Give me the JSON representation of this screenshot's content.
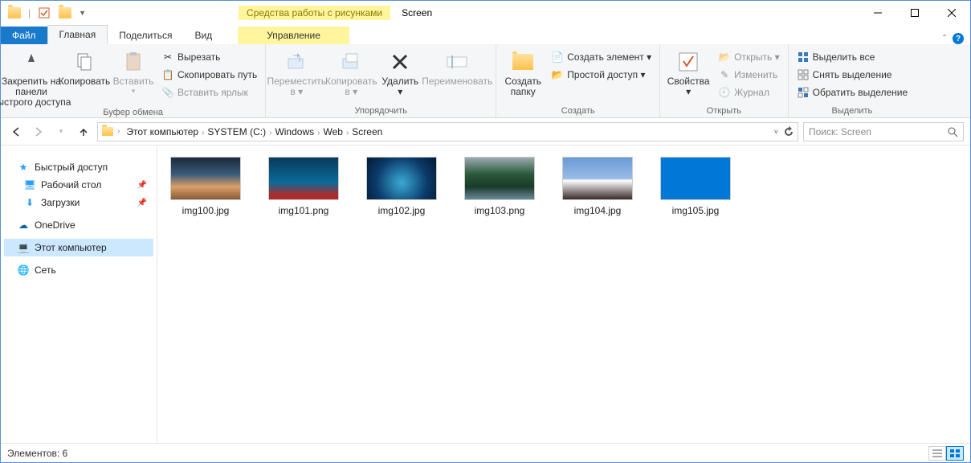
{
  "title": "Screen",
  "contextTabTitle": "Средства работы с рисунками",
  "tabs": {
    "file": "Файл",
    "home": "Главная",
    "share": "Поделиться",
    "view": "Вид",
    "manage": "Управление"
  },
  "ribbon": {
    "clipboard": {
      "label": "Буфер обмена",
      "pin": "Закрепить на панели\nбыстрого доступа",
      "copy": "Копировать",
      "paste": "Вставить",
      "cut": "Вырезать",
      "copypath": "Скопировать путь",
      "pastelink": "Вставить ярлык"
    },
    "organize": {
      "label": "Упорядочить",
      "moveto": "Переместить\nв ▾",
      "copyto": "Копировать\nв ▾",
      "delete": "Удалить\n▾",
      "rename": "Переименовать"
    },
    "new": {
      "label": "Создать",
      "newfolder": "Создать\nпапку",
      "newitem": "Создать элемент ▾",
      "easyaccess": "Простой доступ ▾"
    },
    "open": {
      "label": "Открыть",
      "properties": "Свойства\n▾",
      "open": "Открыть ▾",
      "edit": "Изменить",
      "history": "Журнал"
    },
    "select": {
      "label": "Выделить",
      "selectall": "Выделить все",
      "selectnone": "Снять выделение",
      "invert": "Обратить выделение"
    }
  },
  "breadcrumbs": [
    "Этот компьютер",
    "SYSTEM (C:)",
    "Windows",
    "Web",
    "Screen"
  ],
  "searchPlaceholder": "Поиск: Screen",
  "nav": {
    "quick": "Быстрый доступ",
    "desktop": "Рабочий стол",
    "downloads": "Загрузки",
    "onedrive": "OneDrive",
    "thispc": "Этот компьютер",
    "network": "Сеть"
  },
  "files": [
    {
      "name": "img100.jpg",
      "bg": "linear-gradient(180deg,#1a2a3a 0%,#3a5a7a 40%,#d9a066 70%,#8a5a3a 100%)"
    },
    {
      "name": "img101.png",
      "bg": "linear-gradient(180deg,#0a3a5a 0%,#0a6a9a 60%,#b02a2a 90%)"
    },
    {
      "name": "img102.jpg",
      "bg": "radial-gradient(circle at 50% 60%,#3aaad6 0%,#0a3a6a 60%,#051a33 100%)"
    },
    {
      "name": "img103.png",
      "bg": "linear-gradient(180deg,#9aaab0 0%,#2a5a3a 40%,#1a3a2a 70%,#6a8a9a 100%)"
    },
    {
      "name": "img104.jpg",
      "bg": "linear-gradient(180deg,#6a9ad6 0%,#9abae6 50%,#fff 55%,#3a2a2a 100%)"
    },
    {
      "name": "img105.jpg",
      "bg": "#0078d7"
    }
  ],
  "status": "Элементов: 6"
}
